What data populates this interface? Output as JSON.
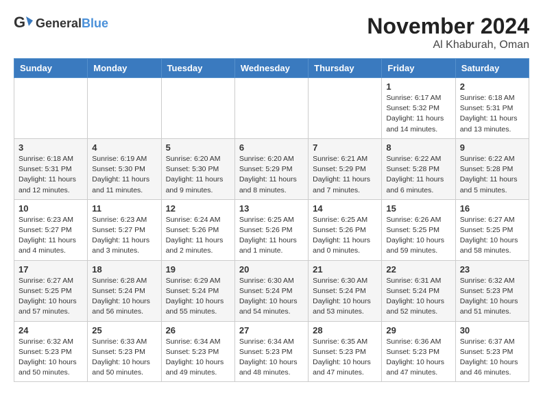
{
  "logo": {
    "general": "General",
    "blue": "Blue"
  },
  "title": "November 2024",
  "location": "Al Khaburah, Oman",
  "weekdays": [
    "Sunday",
    "Monday",
    "Tuesday",
    "Wednesday",
    "Thursday",
    "Friday",
    "Saturday"
  ],
  "weeks": [
    [
      {
        "day": "",
        "detail": ""
      },
      {
        "day": "",
        "detail": ""
      },
      {
        "day": "",
        "detail": ""
      },
      {
        "day": "",
        "detail": ""
      },
      {
        "day": "",
        "detail": ""
      },
      {
        "day": "1",
        "detail": "Sunrise: 6:17 AM\nSunset: 5:32 PM\nDaylight: 11 hours and 14 minutes."
      },
      {
        "day": "2",
        "detail": "Sunrise: 6:18 AM\nSunset: 5:31 PM\nDaylight: 11 hours and 13 minutes."
      }
    ],
    [
      {
        "day": "3",
        "detail": "Sunrise: 6:18 AM\nSunset: 5:31 PM\nDaylight: 11 hours and 12 minutes."
      },
      {
        "day": "4",
        "detail": "Sunrise: 6:19 AM\nSunset: 5:30 PM\nDaylight: 11 hours and 11 minutes."
      },
      {
        "day": "5",
        "detail": "Sunrise: 6:20 AM\nSunset: 5:30 PM\nDaylight: 11 hours and 9 minutes."
      },
      {
        "day": "6",
        "detail": "Sunrise: 6:20 AM\nSunset: 5:29 PM\nDaylight: 11 hours and 8 minutes."
      },
      {
        "day": "7",
        "detail": "Sunrise: 6:21 AM\nSunset: 5:29 PM\nDaylight: 11 hours and 7 minutes."
      },
      {
        "day": "8",
        "detail": "Sunrise: 6:22 AM\nSunset: 5:28 PM\nDaylight: 11 hours and 6 minutes."
      },
      {
        "day": "9",
        "detail": "Sunrise: 6:22 AM\nSunset: 5:28 PM\nDaylight: 11 hours and 5 minutes."
      }
    ],
    [
      {
        "day": "10",
        "detail": "Sunrise: 6:23 AM\nSunset: 5:27 PM\nDaylight: 11 hours and 4 minutes."
      },
      {
        "day": "11",
        "detail": "Sunrise: 6:23 AM\nSunset: 5:27 PM\nDaylight: 11 hours and 3 minutes."
      },
      {
        "day": "12",
        "detail": "Sunrise: 6:24 AM\nSunset: 5:26 PM\nDaylight: 11 hours and 2 minutes."
      },
      {
        "day": "13",
        "detail": "Sunrise: 6:25 AM\nSunset: 5:26 PM\nDaylight: 11 hours and 1 minute."
      },
      {
        "day": "14",
        "detail": "Sunrise: 6:25 AM\nSunset: 5:26 PM\nDaylight: 11 hours and 0 minutes."
      },
      {
        "day": "15",
        "detail": "Sunrise: 6:26 AM\nSunset: 5:25 PM\nDaylight: 10 hours and 59 minutes."
      },
      {
        "day": "16",
        "detail": "Sunrise: 6:27 AM\nSunset: 5:25 PM\nDaylight: 10 hours and 58 minutes."
      }
    ],
    [
      {
        "day": "17",
        "detail": "Sunrise: 6:27 AM\nSunset: 5:25 PM\nDaylight: 10 hours and 57 minutes."
      },
      {
        "day": "18",
        "detail": "Sunrise: 6:28 AM\nSunset: 5:24 PM\nDaylight: 10 hours and 56 minutes."
      },
      {
        "day": "19",
        "detail": "Sunrise: 6:29 AM\nSunset: 5:24 PM\nDaylight: 10 hours and 55 minutes."
      },
      {
        "day": "20",
        "detail": "Sunrise: 6:30 AM\nSunset: 5:24 PM\nDaylight: 10 hours and 54 minutes."
      },
      {
        "day": "21",
        "detail": "Sunrise: 6:30 AM\nSunset: 5:24 PM\nDaylight: 10 hours and 53 minutes."
      },
      {
        "day": "22",
        "detail": "Sunrise: 6:31 AM\nSunset: 5:24 PM\nDaylight: 10 hours and 52 minutes."
      },
      {
        "day": "23",
        "detail": "Sunrise: 6:32 AM\nSunset: 5:23 PM\nDaylight: 10 hours and 51 minutes."
      }
    ],
    [
      {
        "day": "24",
        "detail": "Sunrise: 6:32 AM\nSunset: 5:23 PM\nDaylight: 10 hours and 50 minutes."
      },
      {
        "day": "25",
        "detail": "Sunrise: 6:33 AM\nSunset: 5:23 PM\nDaylight: 10 hours and 50 minutes."
      },
      {
        "day": "26",
        "detail": "Sunrise: 6:34 AM\nSunset: 5:23 PM\nDaylight: 10 hours and 49 minutes."
      },
      {
        "day": "27",
        "detail": "Sunrise: 6:34 AM\nSunset: 5:23 PM\nDaylight: 10 hours and 48 minutes."
      },
      {
        "day": "28",
        "detail": "Sunrise: 6:35 AM\nSunset: 5:23 PM\nDaylight: 10 hours and 47 minutes."
      },
      {
        "day": "29",
        "detail": "Sunrise: 6:36 AM\nSunset: 5:23 PM\nDaylight: 10 hours and 47 minutes."
      },
      {
        "day": "30",
        "detail": "Sunrise: 6:37 AM\nSunset: 5:23 PM\nDaylight: 10 hours and 46 minutes."
      }
    ]
  ]
}
